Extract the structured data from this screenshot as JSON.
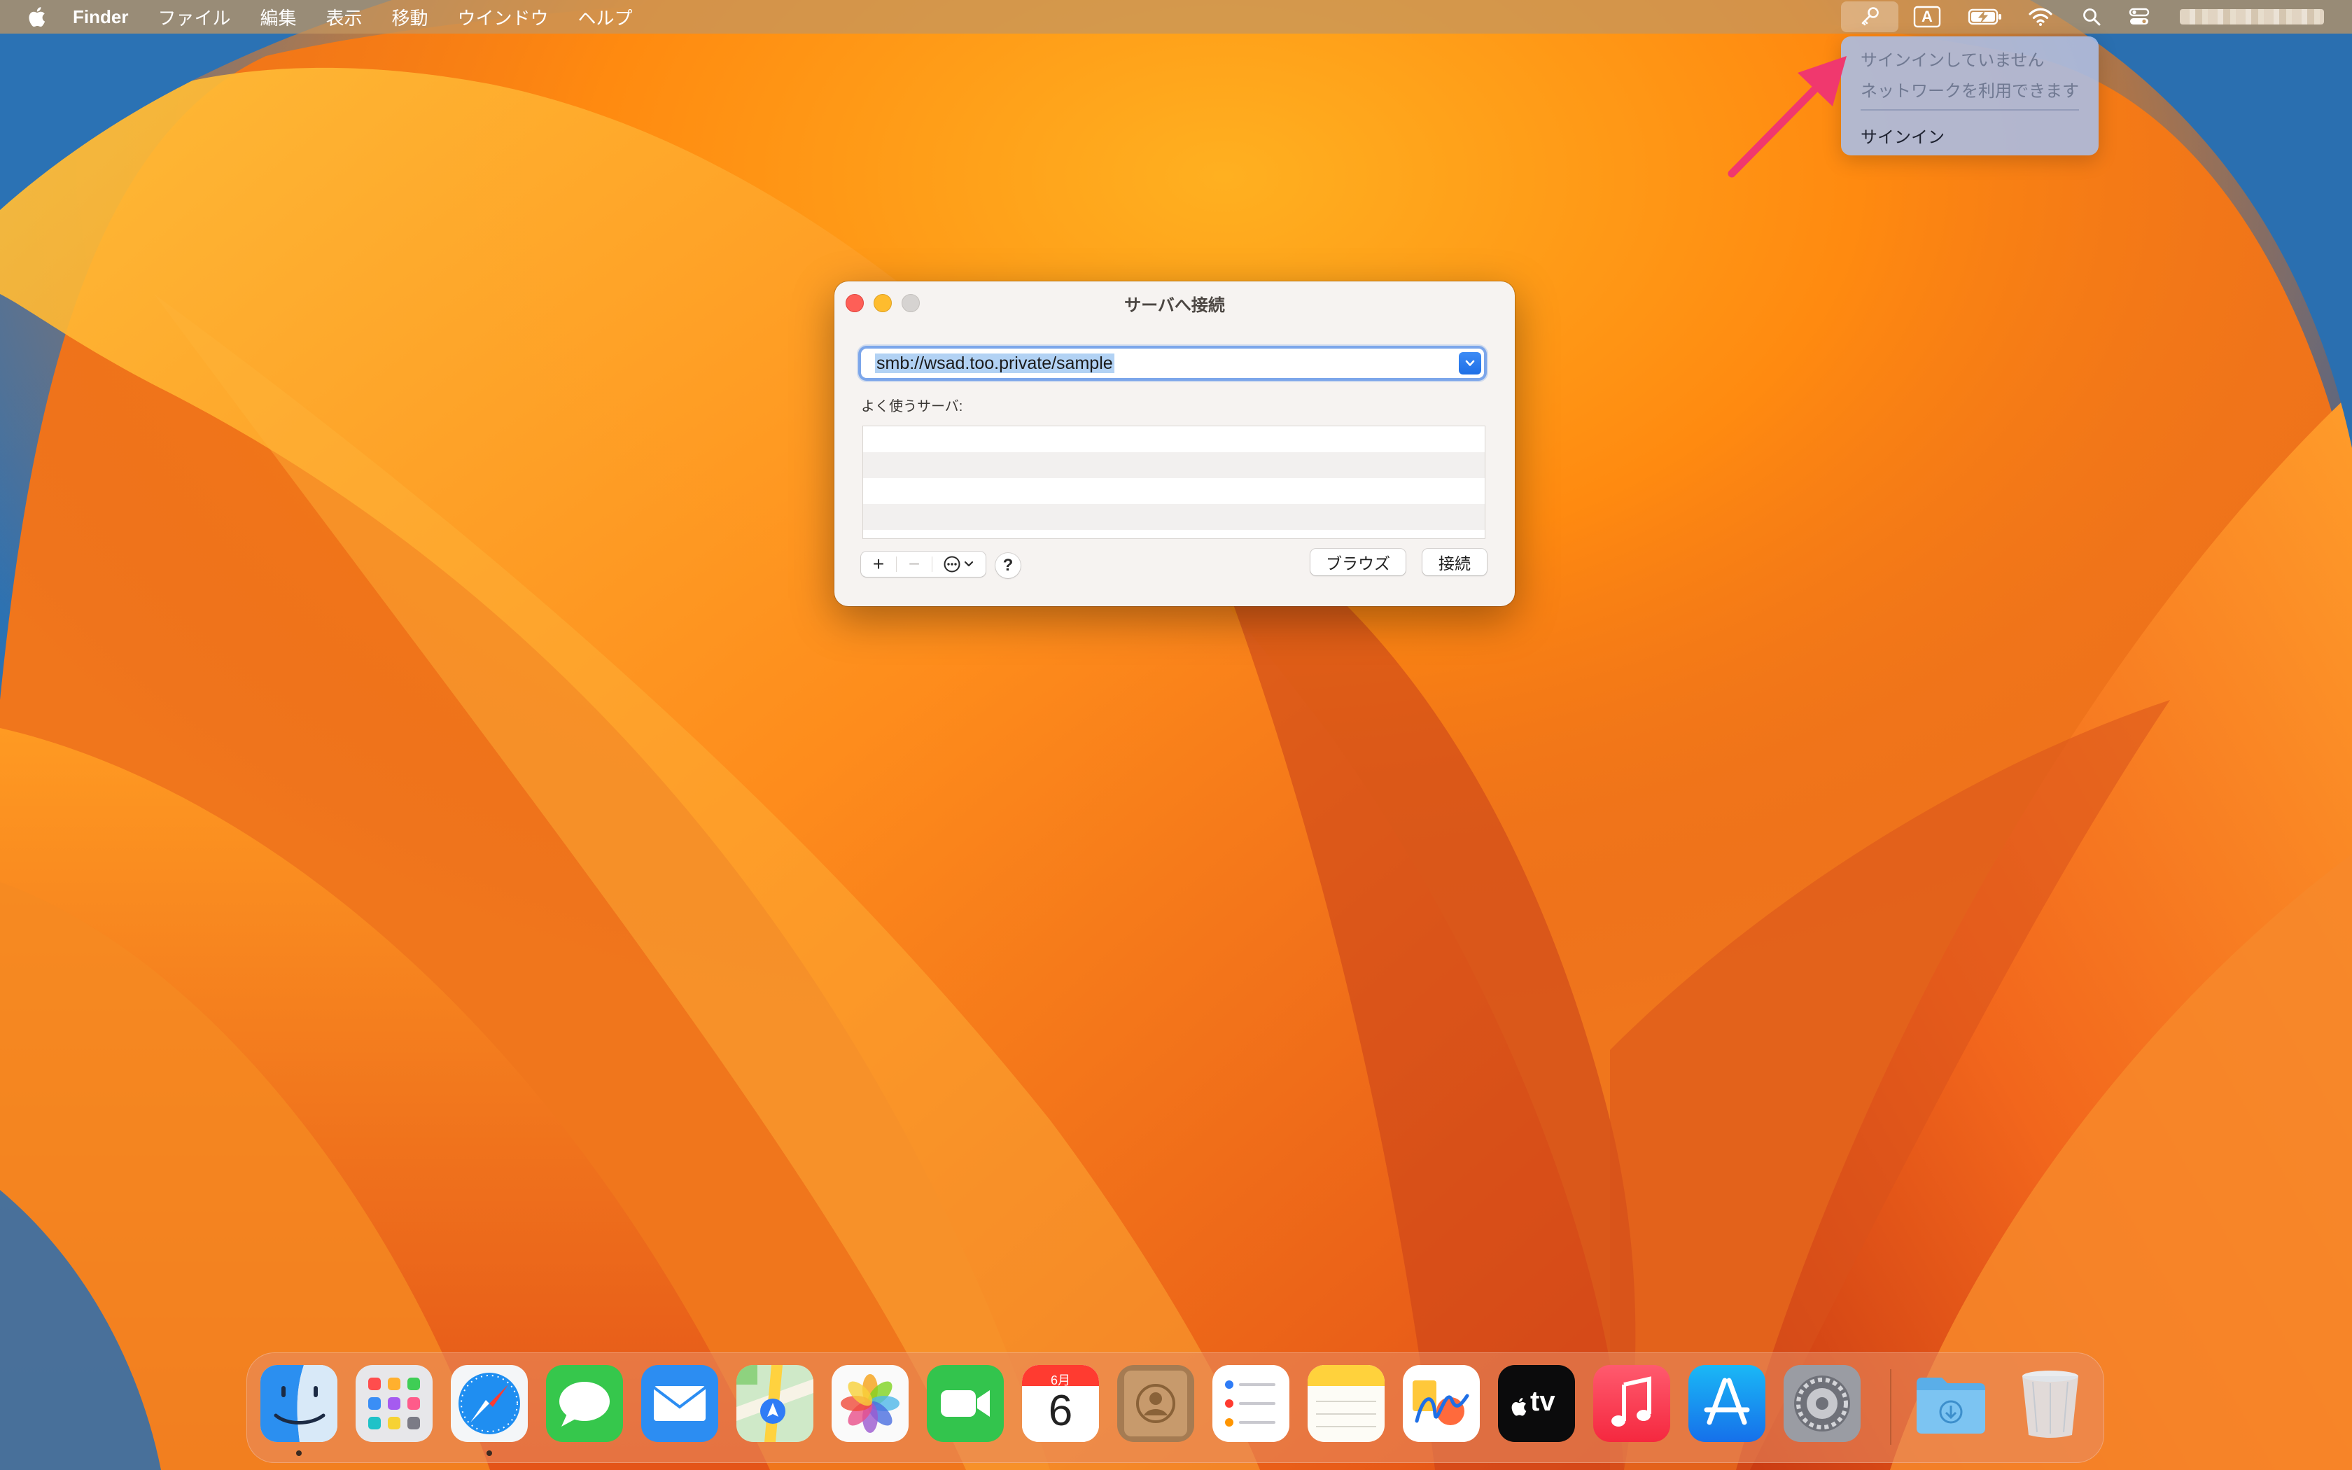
{
  "menubar": {
    "app_name": "Finder",
    "items": [
      "ファイル",
      "編集",
      "表示",
      "移動",
      "ウインドウ",
      "ヘルプ"
    ],
    "status_icons": [
      "keychain-icon",
      "input-source-icon",
      "battery-charging-icon",
      "wifi-icon",
      "spotlight-icon",
      "control-center-icon"
    ],
    "input_source_letter": "A"
  },
  "keychain_menu": {
    "status_line1": "サインインしていません",
    "status_line2": "ネットワークを利用できます",
    "sign_in": "サインイン"
  },
  "dialog": {
    "title": "サーバへ接続",
    "server_address": "smb://wsad.too.private/sample",
    "favorites_label": "よく使うサーバ:",
    "favorites": [],
    "add_symbol": "+",
    "remove_symbol": "−",
    "help_symbol": "?",
    "browse_label": "ブラウズ",
    "connect_label": "接続"
  },
  "dock": {
    "apps": [
      "Finder",
      "Launchpad",
      "Safari",
      "Messages",
      "Mail",
      "Maps",
      "Photos",
      "FaceTime",
      "Calendar",
      "Contacts",
      "Reminders",
      "Notes",
      "Freeform",
      "TV",
      "Music",
      "App Store",
      "System Settings",
      "Downloads",
      "Trash"
    ],
    "calendar_month": "6月",
    "calendar_day": "6",
    "tv_label": "tv",
    "running": [
      "Finder",
      "Safari"
    ]
  },
  "colors": {
    "accent": "#1e6fe6",
    "annotation_arrow": "#f0386e",
    "close": "#fe5f57",
    "minimize": "#febc2e"
  }
}
